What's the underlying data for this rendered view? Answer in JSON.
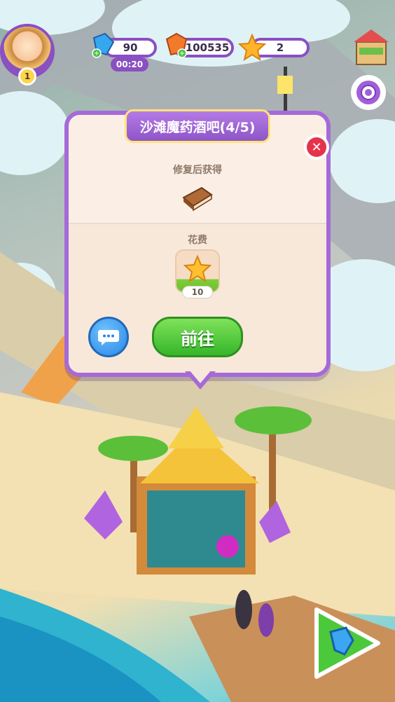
{
  "hud": {
    "currency_blue": "90",
    "timer": "00:20",
    "currency_gems": "100535",
    "currency_stars": "2",
    "player_level": "1"
  },
  "dialog": {
    "title": "沙滩魔药酒吧(4/5)",
    "reward_label": "修复后获得",
    "cost_label": "花费",
    "cost_amount": "10",
    "go_label": "前往"
  },
  "icons": {
    "blue_currency": "blue-gem-icon",
    "gem_currency": "orange-gem-icon",
    "star_currency": "star-icon",
    "settings": "gear-icon",
    "shop": "shop-icon",
    "close": "close-icon",
    "chat": "chat-icon",
    "reward": "book-icon",
    "play": "play-icon"
  },
  "colors": {
    "accent_purple": "#8a4fc2",
    "go_green": "#36b62a",
    "close_red": "#e4334a",
    "chat_blue": "#2a86e6"
  }
}
